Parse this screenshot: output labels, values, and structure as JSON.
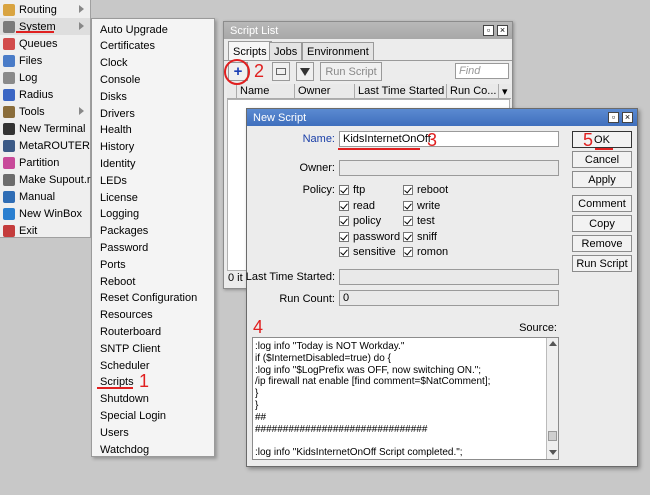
{
  "sidebar": {
    "items": [
      {
        "label": "Routing",
        "icon": "routing-icon",
        "submenu": true
      },
      {
        "label": "System",
        "icon": "gear-icon",
        "submenu": true
      },
      {
        "label": "Queues",
        "icon": "queues-icon",
        "submenu": false
      },
      {
        "label": "Files",
        "icon": "folder-icon",
        "submenu": false
      },
      {
        "label": "Log",
        "icon": "log-icon",
        "submenu": false
      },
      {
        "label": "Radius",
        "icon": "radius-icon",
        "submenu": false
      },
      {
        "label": "Tools",
        "icon": "tools-icon",
        "submenu": true
      },
      {
        "label": "New Terminal",
        "icon": "terminal-icon",
        "submenu": false
      },
      {
        "label": "MetaROUTER",
        "icon": "metarouter-icon",
        "submenu": false
      },
      {
        "label": "Partition",
        "icon": "partition-icon",
        "submenu": false
      },
      {
        "label": "Make Supout.rif",
        "icon": "supout-icon",
        "submenu": false
      },
      {
        "label": "Manual",
        "icon": "help-icon",
        "submenu": false
      },
      {
        "label": "New WinBox",
        "icon": "winbox-icon",
        "submenu": false
      },
      {
        "label": "Exit",
        "icon": "exit-icon",
        "submenu": false
      }
    ]
  },
  "submenu": {
    "items": [
      "Auto Upgrade",
      "Certificates",
      "Clock",
      "Console",
      "Disks",
      "Drivers",
      "Health",
      "History",
      "Identity",
      "LEDs",
      "License",
      "Logging",
      "Packages",
      "Password",
      "Ports",
      "Reboot",
      "Reset Configuration",
      "Resources",
      "Routerboard",
      "SNTP Client",
      "Scheduler",
      "Scripts",
      "Shutdown",
      "Special Login",
      "Users",
      "Watchdog"
    ]
  },
  "script_list": {
    "title": "Script List",
    "tabs": [
      "Scripts",
      "Jobs",
      "Environment"
    ],
    "run_script_label": "Run Script",
    "find_placeholder": "Find",
    "columns": [
      "Name",
      "Owner",
      "Last Time Started",
      "Run Co..."
    ],
    "status": "0 it"
  },
  "new_script": {
    "title": "New Script",
    "name_label": "Name:",
    "name_value": "KidsInternetOnOff",
    "owner_label": "Owner:",
    "policy_label": "Policy:",
    "policies": [
      [
        "ftp",
        "reboot"
      ],
      [
        "read",
        "write"
      ],
      [
        "policy",
        "test"
      ],
      [
        "password",
        "sniff"
      ],
      [
        "sensitive",
        "romon"
      ]
    ],
    "last_started_label": "Last Time Started:",
    "run_count_label": "Run Count:",
    "run_count_value": "0",
    "source_label": "Source:",
    "source_lines": [
      ":log info \"Today is NOT Workday.\"",
      "if ($InternetDisabled=true) do {",
      ":log info \"$LogPrefix was OFF, now switching ON.\";",
      "/ip firewall nat enable [find comment=$NatComment];",
      "}",
      "}",
      "##",
      "###############################",
      "",
      ":log info \"KidsInternetOnOff Script completed.\";"
    ],
    "buttons": [
      "OK",
      "Cancel",
      "Apply",
      "Comment",
      "Copy",
      "Remove",
      "Run Script"
    ]
  },
  "annotations": [
    "1",
    "2",
    "3",
    "4",
    "5"
  ],
  "colors": {
    "annotation": "#e02020",
    "title_active": "#4a7cc8",
    "title_inactive": "#b0b0b0"
  }
}
